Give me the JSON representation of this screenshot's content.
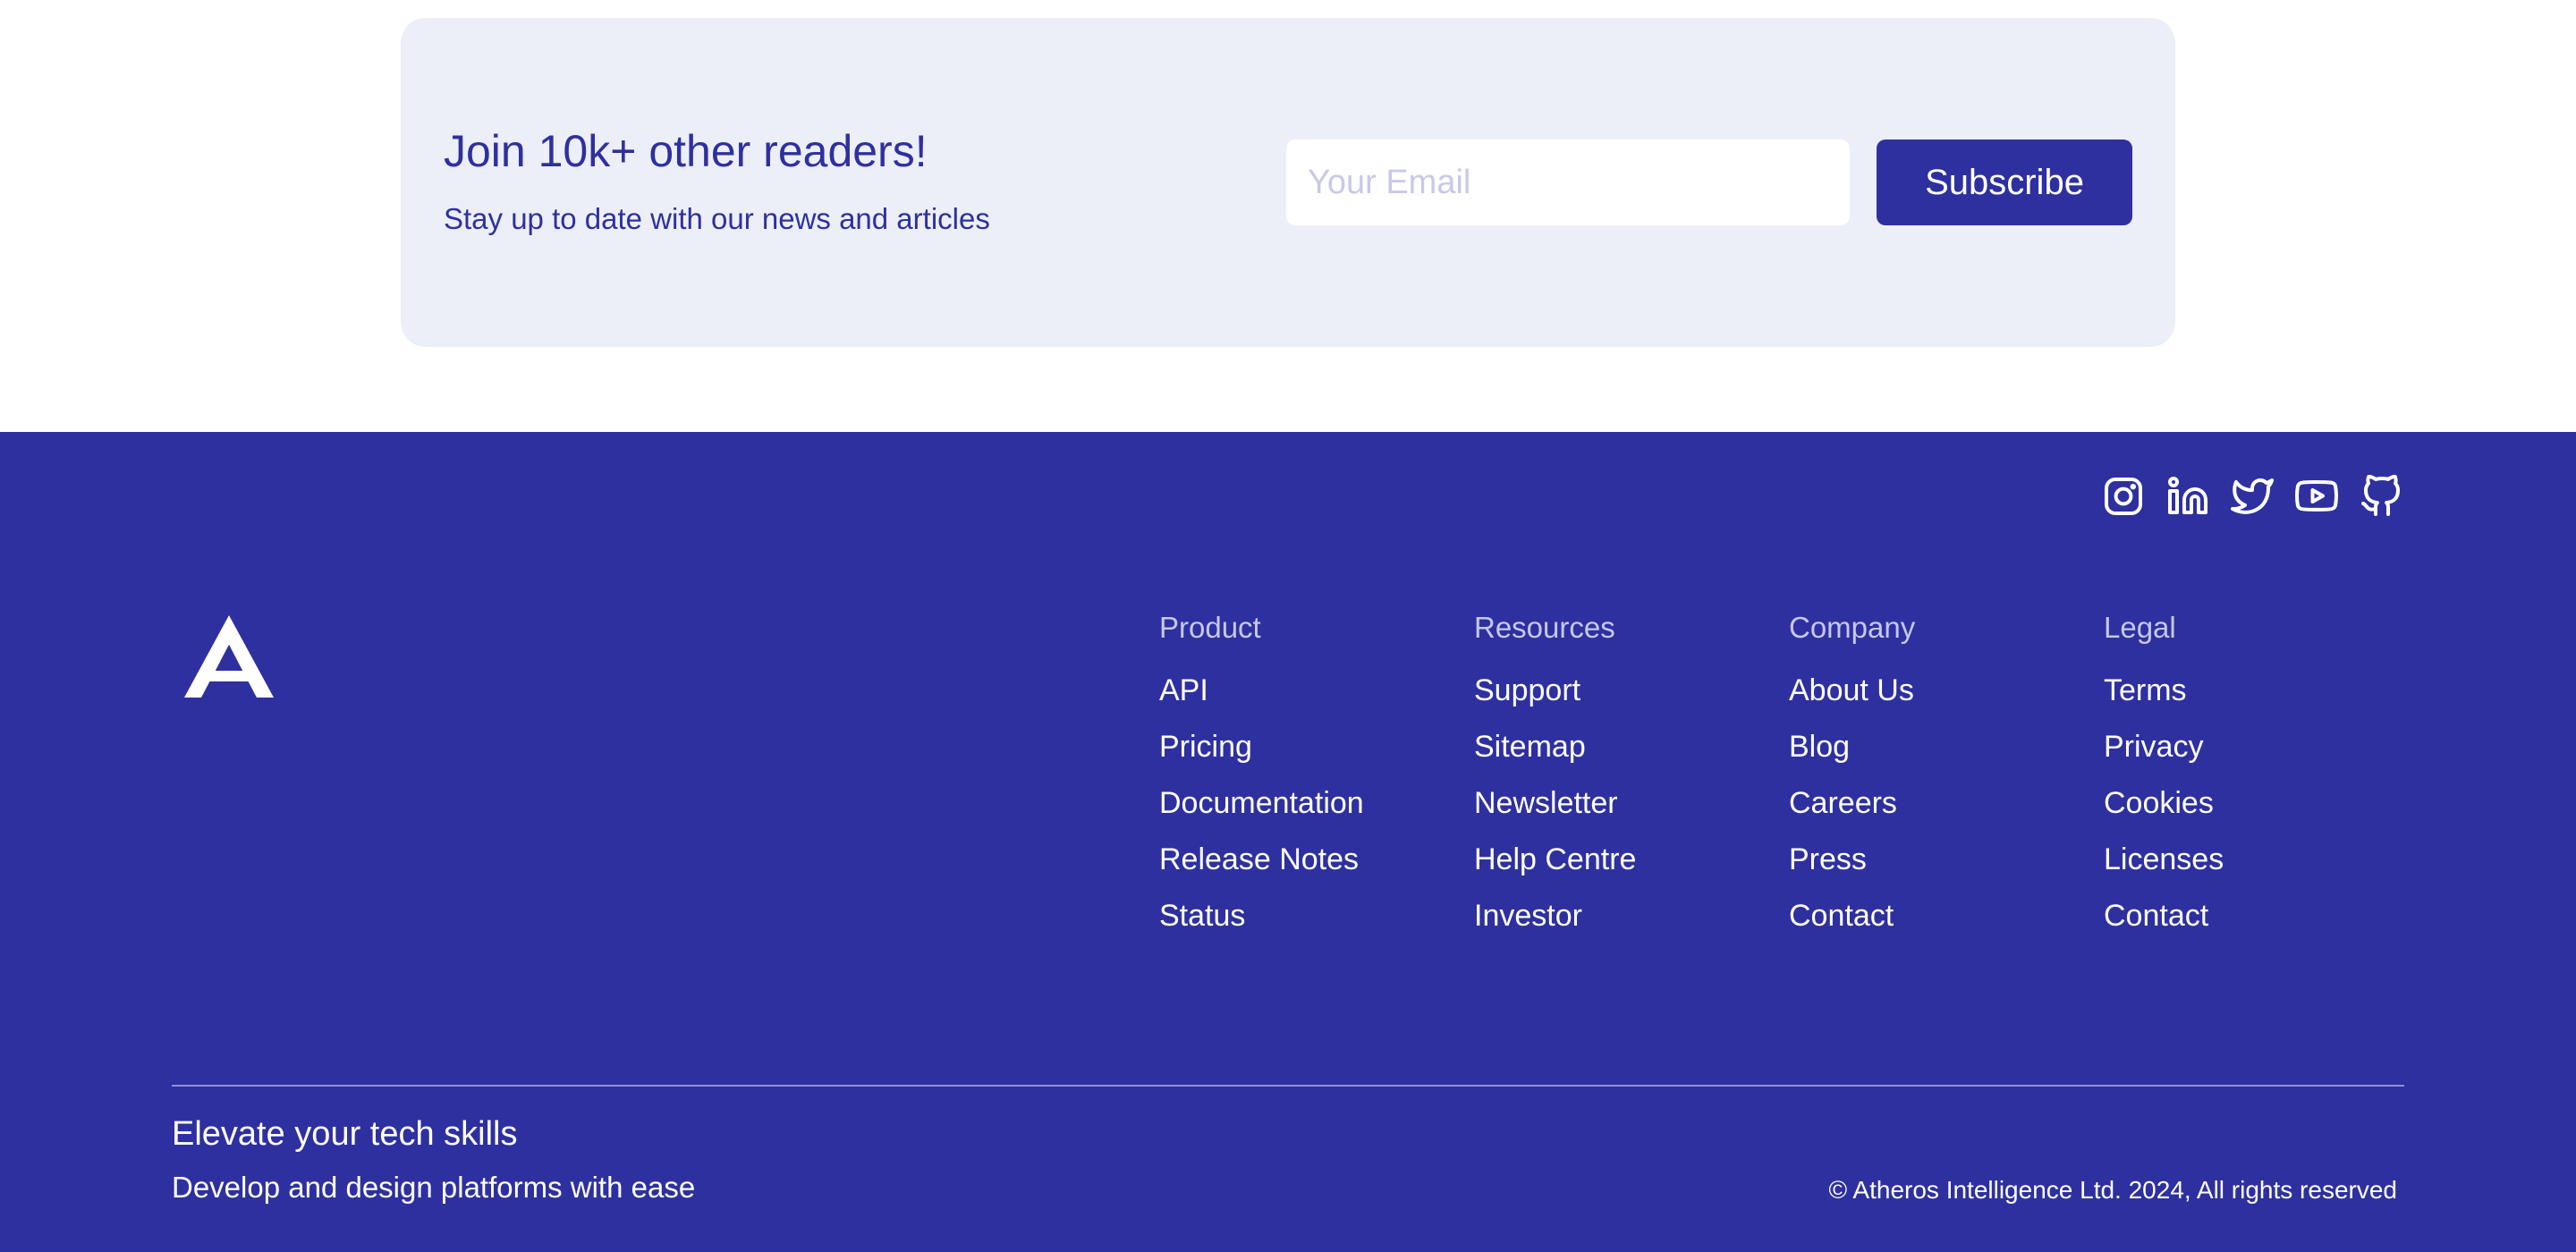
{
  "newsletter": {
    "heading": "Join 10k+ other readers!",
    "subheading": "Stay up to date with our news and articles",
    "email_placeholder": "Your Email",
    "email_value": "",
    "subscribe_label": "Subscribe"
  },
  "footer": {
    "social_icons": [
      "instagram-icon",
      "linkedin-icon",
      "twitter-icon",
      "youtube-icon",
      "github-icon"
    ],
    "columns": [
      {
        "title": "Product",
        "links": [
          "API",
          "Pricing",
          "Documentation",
          "Release Notes",
          "Status"
        ]
      },
      {
        "title": "Resources",
        "links": [
          "Support",
          "Sitemap",
          "Newsletter",
          "Help Centre",
          "Investor"
        ]
      },
      {
        "title": "Company",
        "links": [
          "About Us",
          "Blog",
          "Careers",
          "Press",
          "Contact"
        ]
      },
      {
        "title": "Legal",
        "links": [
          "Terms",
          "Privacy",
          "Cookies",
          "Licenses",
          "Contact"
        ]
      }
    ],
    "tagline": "Elevate your tech skills",
    "tagline_sub": "Develop and design platforms with ease",
    "copyright": "© Atheros Intelligence Ltd. 2024, All rights reserved"
  },
  "colors": {
    "brand": "#2e30a0",
    "card_bg": "#eceff7",
    "muted_heading": "#c5c7ee",
    "placeholder": "#c8c8ec"
  }
}
